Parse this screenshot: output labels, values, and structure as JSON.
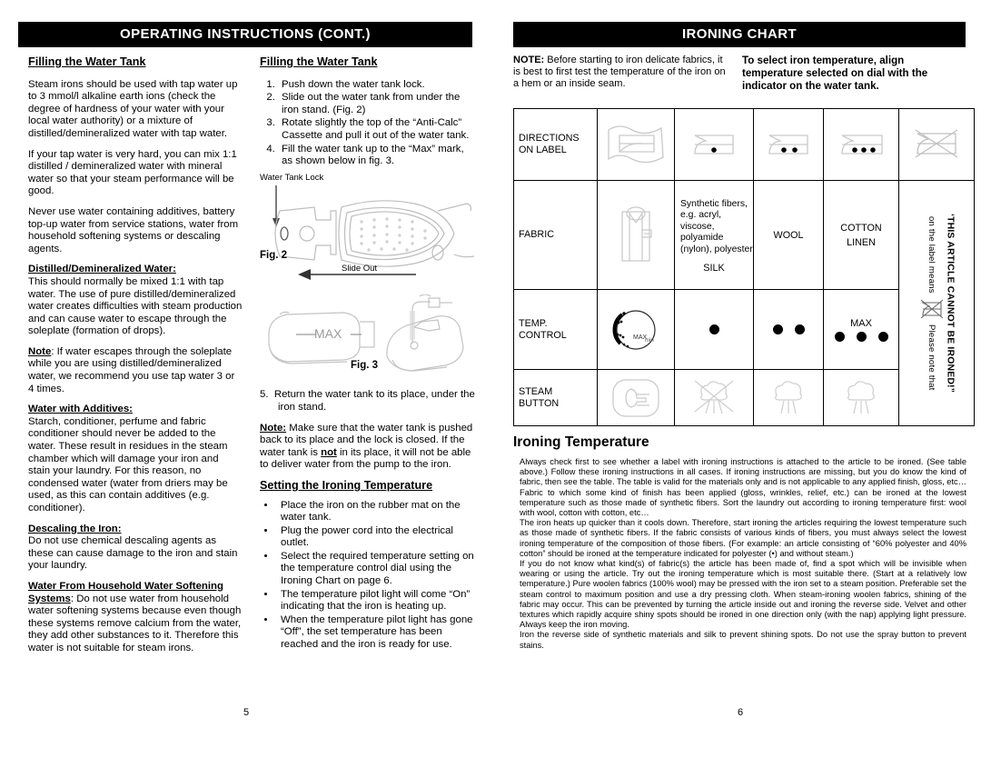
{
  "left_page": {
    "banner": "OPERATING INSTRUCTIONS (CONT.)",
    "page_number": "5",
    "column_a": {
      "heading": "Filling the Water Tank",
      "p1": "Steam irons should be used with tap water up to 3 mmol/l alkaline earth ions (check the degree of hardness of your water with your local water authority) or a mixture of distilled/demineralized water with tap water.",
      "p2": "If your tap water is very hard, you can mix 1:1 distilled / demineralized water with mineral water so that your steam performance will be good.",
      "p3": "Never use water containing additives, battery top-up water from service stations, water from household softening systems or descaling agents.",
      "sub1_title": "Distilled/Demineralized Water:",
      "sub1_body": "This should normally be mixed 1:1 with tap water. The use of pure distilled/demineralized water creates difficulties with steam production and can cause water to escape through the soleplate (formation of drops).",
      "note_label": "Note",
      "note_body": ":   If water escapes through the soleplate while you are using distilled/demineralized water, we recommend you use tap water 3 or 4 times.",
      "sub2_title": "Water with Additives:",
      "sub2_body": "Starch, conditioner, perfume and fabric conditioner should never be added to the water.  These result in residues in the steam chamber which will damage your iron and stain your laundry.  For this reason, no condensed water (water from driers may be used, as this can contain additives (e.g. conditioner).",
      "sub3_title": "Descaling the Iron:",
      "sub3_body": "Do not use chemical descaling agents as these can cause damage to the iron and stain your laundry.",
      "sub4_title": "Water From Household Water Softening Systems",
      "sub4_body": ": Do not use water from household water softening systems because even though these systems remove calcium from the water, they add other substances to it. Therefore this water is not suitable for steam irons."
    },
    "column_b": {
      "heading": "Filling the Water Tank",
      "steps": [
        "Push down the water tank lock.",
        "Slide out the water tank from under the iron stand. (Fig. 2)",
        "Rotate slightly the top of the “Anti-Calc” Cassette and pull it out of the water tank.",
        "Fill the water tank up to the “Max” mark, as shown below in fig. 3."
      ],
      "fig2": {
        "callout": "Water Tank Lock",
        "label": "Fig. 2",
        "arrow_label": "Slide Out"
      },
      "fig3": {
        "label": "Fig. 3",
        "max_label": "MAX"
      },
      "step5_number": "5.",
      "step5": "Return the water tank to its place, under the iron stand.",
      "note_label": "Note:",
      "note_part1": " Make sure that the water tank is pushed back to its place and the lock is closed.  If the water tank is ",
      "note_bold": "not",
      "note_part2": " in its place, it will not be able to deliver water from the pump to the iron.",
      "sub_heading": "Setting the Ironing Temperature",
      "bullets": [
        "Place the iron on the rubber mat on the water tank.",
        "Plug the power cord into the electrical outlet.",
        "Select the required temperature setting on the temperature control dial using the Ironing Chart on page 6.",
        "The temperature pilot light will come “On” indicating that the iron is heating up.",
        "When the temperature pilot light has gone “Off”, the set temperature has been reached and the iron is ready for use."
      ]
    }
  },
  "right_page": {
    "banner": "IRONING CHART",
    "page_number": "6",
    "note_label": "NOTE:",
    "note_text": " Before starting to iron delicate fabrics, it is best to first test the temperature of the iron on a hem or an inside seam.",
    "align_text": "To select iron temperature, align temperature selected on dial with the indicator on the water tank.",
    "table": {
      "rows": [
        {
          "label": "DIRECTIONS ON LABEL",
          "label_line1": "DIRECTIONS",
          "label_line2": "ON LABEL",
          "cells": [
            "fabric-wave-icon",
            "iron-one-dot-icon",
            "iron-two-dots-icon",
            "iron-three-dots-icon",
            "iron-crossed-icon"
          ]
        },
        {
          "label": "FABRIC",
          "cells": [
            "shirt-icon",
            "Synthetic fibers, e.g. acryl, viscose, polyamide (nylon), polyester",
            "WOOL",
            "COTTON",
            ""
          ],
          "silk": "SILK",
          "cotton_line2": "LINEN"
        },
        {
          "label": "TEMP. CONTROL",
          "label_line1": "TEMP.",
          "label_line2": "CONTROL",
          "cells": [
            "temperature-dial-icon",
            "1",
            "2",
            "3",
            ""
          ],
          "max_label": "MAX"
        },
        {
          "label": "STEAM BUTTON",
          "label_line1": "STEAM",
          "label_line2": "BUTTON",
          "cells": [
            "steam-button-icon",
            "steam-crossed-icon",
            "steam-cloud-icon",
            "steam-cloud-icon",
            ""
          ]
        }
      ],
      "vertical_note_plain_1": "Please note that",
      "vertical_note_plain_2": "on the label means",
      "vertical_note_bold": "‘THIS ARTICLE CANNOT BE IRONED!”"
    },
    "ironing_temperature": {
      "heading": "Ironing Temperature",
      "p1": "Always check first to see whether a label with ironing instructions is attached to the article to be ironed. (See table above.)  Follow these ironing instructions in all cases.  If ironing instructions are missing, but you do know the kind of fabric, then see the table.  The table is valid for the materials only and is not applicable to any applied finish, gloss, etc…  Fabric to which some kind of finish has been applied (gloss, wrinkles, relief, etc.) can be ironed at the lowest temperature such as those made of synthetic fibers.  Sort the laundry out according to ironing temperature first: wool with wool, cotton with cotton, etc…",
      "p2": "The iron heats up quicker than it cools down.  Therefore, start ironing the articles requiring the lowest temperature such as those made of synthetic fibers.  If the fabric consists of various kinds of fibers, you must always select the lowest ironing temperature of the composition of those fibers.  (For example: an article consisting of “60% polyester and 40% cotton” should be ironed at the temperature indicated for polyester (•) and without steam.)",
      "p3": "If you do not know what kind(s) of fabric(s) the article has been made of, find a spot which will be invisible when wearing or using the article.  Try out the ironing temperature which is most suitable there.  (Start at a relatively low temperature.)  Pure woolen fabrics (100% wool) may be pressed with the iron set to a steam position.  Preferable set the steam control to maximum position and use a dry pressing cloth.  When steam-ironing woolen fabrics, shining of the fabric may occur.  This can be prevented by turning the article inside out and ironing the reverse side.  Velvet and other textures which rapidly acquire shiny spots should be ironed in one direction only (with the nap) applying light pressure.  Always keep the iron moving.",
      "p4": "Iron the reverse side of synthetic materials and silk to prevent shining spots.  Do not use the spray button to prevent stains."
    }
  },
  "colors": {
    "banner_bg": "#000000",
    "banner_text": "#ffffff",
    "text": "#000000",
    "line_art": "#b9b9b9"
  }
}
